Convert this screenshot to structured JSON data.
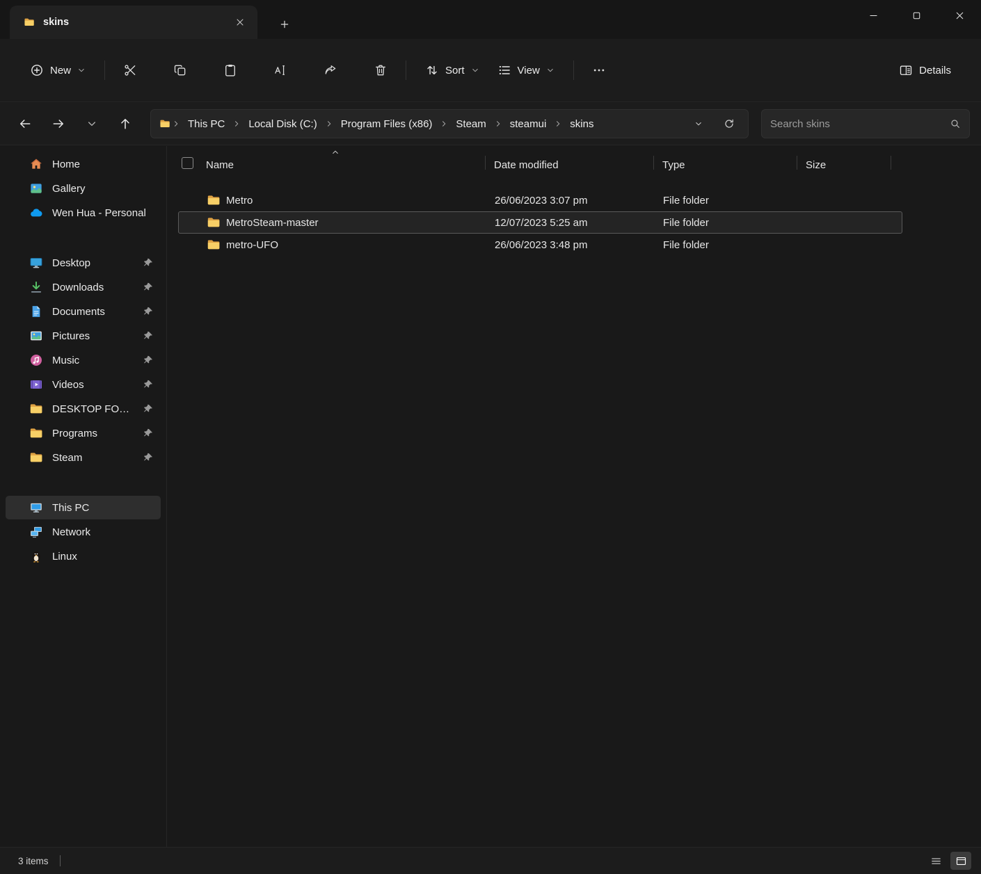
{
  "window": {
    "tab_title": "skins"
  },
  "toolbar": {
    "new_label": "New",
    "sort_label": "Sort",
    "view_label": "View",
    "details_label": "Details"
  },
  "addressbar": {
    "breadcrumbs": [
      "This PC",
      "Local Disk (C:)",
      "Program Files (x86)",
      "Steam",
      "steamui",
      "skins"
    ],
    "search_placeholder": "Search skins"
  },
  "sidebar": {
    "top": [
      {
        "label": "Home"
      },
      {
        "label": "Gallery"
      },
      {
        "label": "Wen Hua - Personal"
      }
    ],
    "pinned": [
      {
        "label": "Desktop"
      },
      {
        "label": "Downloads"
      },
      {
        "label": "Documents"
      },
      {
        "label": "Pictures"
      },
      {
        "label": "Music"
      },
      {
        "label": "Videos"
      },
      {
        "label": "DESKTOP FOLDER"
      },
      {
        "label": "Programs"
      },
      {
        "label": "Steam"
      }
    ],
    "bottom": [
      {
        "label": "This PC"
      },
      {
        "label": "Network"
      },
      {
        "label": "Linux"
      }
    ]
  },
  "main": {
    "columns": {
      "name": "Name",
      "date": "Date modified",
      "type": "Type",
      "size": "Size"
    },
    "rows": [
      {
        "name": "Metro",
        "date": "26/06/2023 3:07 pm",
        "type": "File folder",
        "size": "",
        "selected": false
      },
      {
        "name": "MetroSteam-master",
        "date": "12/07/2023 5:25 am",
        "type": "File folder",
        "size": "",
        "selected": true
      },
      {
        "name": "metro-UFO",
        "date": "26/06/2023 3:48 pm",
        "type": "File folder",
        "size": "",
        "selected": false
      }
    ]
  },
  "statusbar": {
    "items_count": "3 items"
  },
  "icons": {
    "folder": "yellow-folder-shape",
    "search": "magnifier",
    "refresh": "circular-arrow",
    "sort": "up-down-arrows",
    "view": "bulleted-lines",
    "details": "split-panel",
    "pin": "pushpin",
    "new": "plus-in-circle",
    "cut": "scissors",
    "copy": "double-rect",
    "paste": "clipboard",
    "rename": "letter-A-with-cursor",
    "share": "curved-arrow",
    "delete": "trash-can",
    "linux": "penguin",
    "onedrive": "cloud"
  },
  "colors": {
    "background": "#191919",
    "folder_front": "#f7cf66",
    "folder_back": "#dfa243",
    "onedrive_blue": "#0f9af0",
    "selection_border": "#5a5a5a"
  }
}
